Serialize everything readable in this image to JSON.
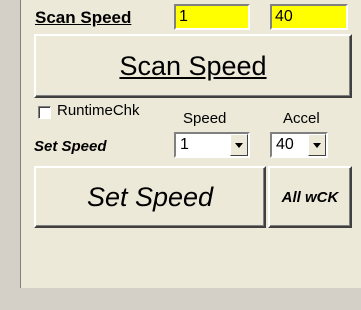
{
  "scan": {
    "label": "Scan Speed",
    "speed_value": "1",
    "accel_value": "40",
    "button_label": "Scan Speed"
  },
  "set": {
    "runtime_chk_label": "RuntimeChk",
    "speed_header": "Speed",
    "accel_header": "Accel",
    "label": "Set Speed",
    "speed_selected": "1",
    "accel_selected": "40",
    "button_label": "Set Speed",
    "all_button_label": "All wCK"
  },
  "colors": {
    "highlight_field": "#ffff00",
    "panel_bg": "#ece9d8"
  }
}
